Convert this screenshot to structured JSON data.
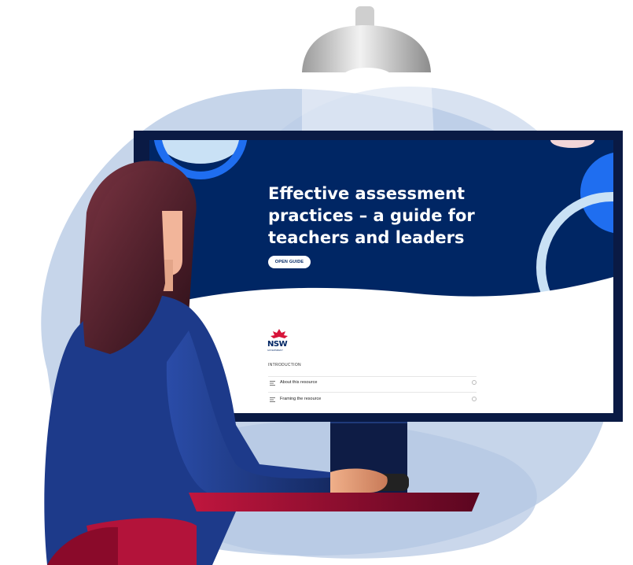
{
  "screen": {
    "title_lines": [
      "Effective assessment",
      "practices – a guide for",
      "teachers and leaders"
    ],
    "open_button": "OPEN GUIDE",
    "logo_text": "NSW",
    "logo_sub": "GOVERNMENT",
    "section_label": "INTRODUCTION",
    "lessons": [
      {
        "label": "About this resource"
      },
      {
        "label": "Framing the resource"
      }
    ]
  },
  "colors": {
    "screen_navy": "#002664",
    "accent_blue": "#1f6ef0",
    "light_blue": "#c9e1f5",
    "blob": "#c6d5ea",
    "sweater": "#1d3a8a",
    "hair": "#4a1f2a",
    "desk": "#8a0a2a",
    "nsw_red": "#d7153a"
  },
  "icons": [
    "lamp-icon",
    "list-icon",
    "radio-icon",
    "nsw-waratah-icon"
  ]
}
